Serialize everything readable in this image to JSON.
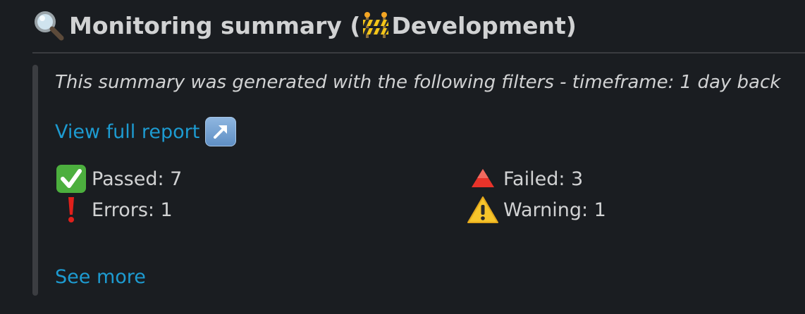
{
  "header": {
    "title_prefix": "Monitoring summary (",
    "environment": "Development",
    "title_suffix": ")",
    "icon": "magnifying-glass-icon",
    "env_icon": "construction-barrier-icon"
  },
  "attachment": {
    "filters_text": "This summary was generated with the following filters - timeframe: 1 day back",
    "report_link": "View full report",
    "report_link_icon": "arrow-up-right-icon",
    "stats": {
      "passed": "Passed: 7",
      "failed": "Failed: 3",
      "errors": "Errors: 1",
      "warning": "Warning: 1"
    },
    "see_more": "See more"
  },
  "colors": {
    "background": "#1a1d21",
    "text": "#d1d2d3",
    "link": "#1d9bd1",
    "accent_bar": "#3b3d41"
  }
}
